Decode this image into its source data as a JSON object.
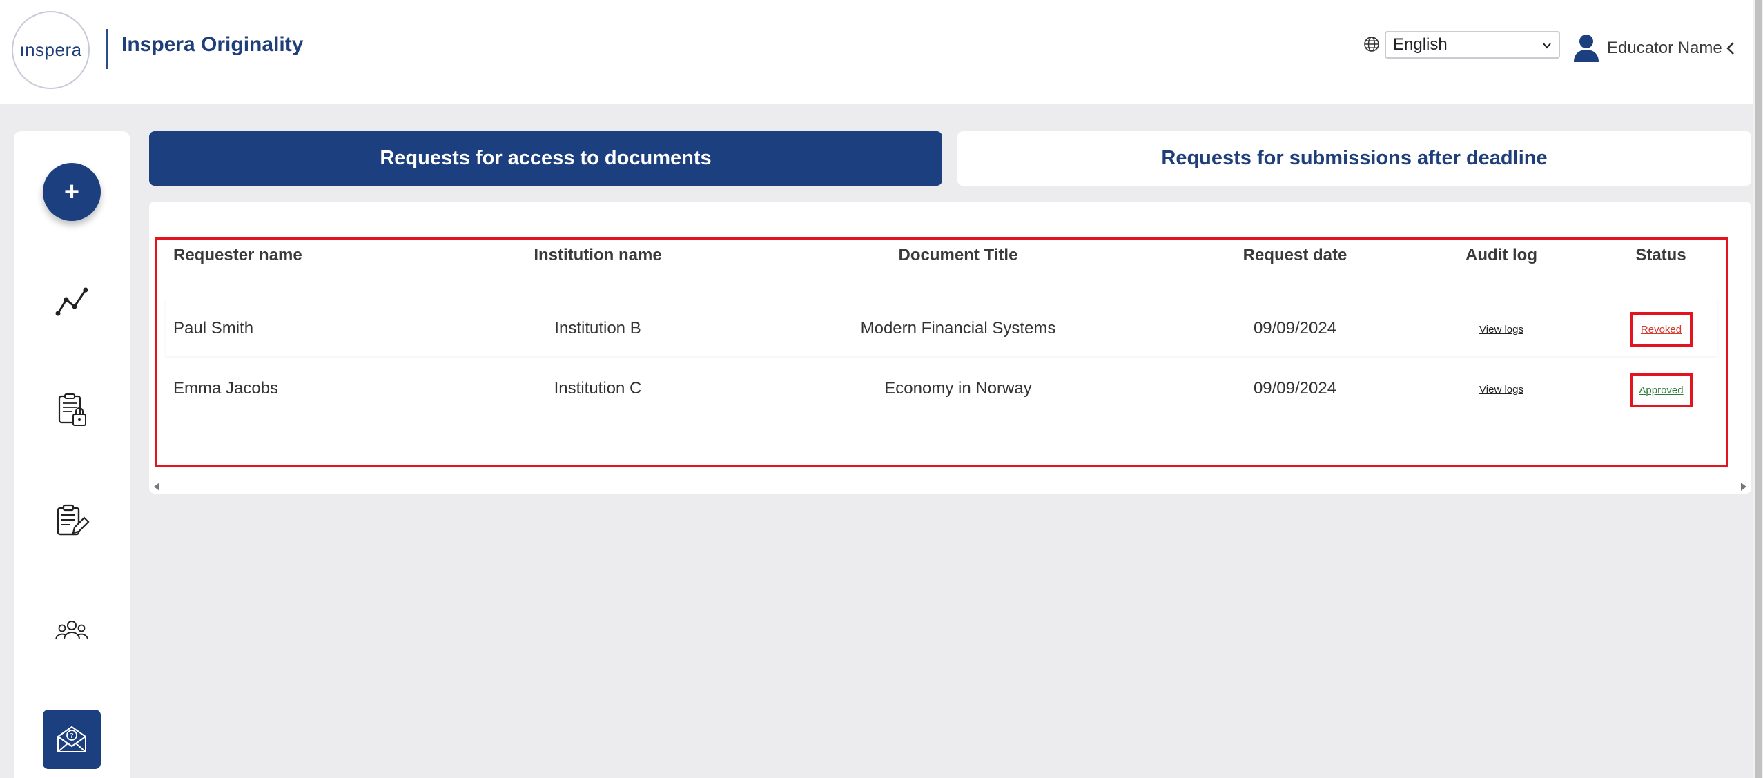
{
  "header": {
    "logo_text": "ınspera",
    "brand_title": "Inspera Originality",
    "language": {
      "selected": "English"
    },
    "user": {
      "name": "Educator Name"
    }
  },
  "sidebar": {
    "add_label": "+",
    "items": [
      {
        "icon": "analytics-icon"
      },
      {
        "icon": "document-lock-icon"
      },
      {
        "icon": "clipboard-edit-icon"
      },
      {
        "icon": "users-group-icon"
      },
      {
        "icon": "mail-help-icon"
      }
    ]
  },
  "tabs": [
    {
      "label": "Requests for access to documents",
      "active": true
    },
    {
      "label": "Requests for submissions after deadline",
      "active": false
    }
  ],
  "table": {
    "columns": [
      "Requester name",
      "Institution name",
      "Document Title",
      "Request date",
      "Audit log",
      "Status"
    ],
    "rows": [
      {
        "requester": "Paul Smith",
        "institution": "Institution B",
        "title": "Modern Financial Systems",
        "date": "09/09/2024",
        "audit": "View logs",
        "status": "Revoked"
      },
      {
        "requester": "Emma Jacobs",
        "institution": "Institution C",
        "title": "Economy in Norway",
        "date": "09/09/2024",
        "audit": "View logs",
        "status": "Approved"
      }
    ]
  },
  "colors": {
    "primary": "#1c3f7f",
    "highlight": "#e3141e",
    "revoked": "#d23b2e",
    "approved": "#2f7a3a"
  }
}
